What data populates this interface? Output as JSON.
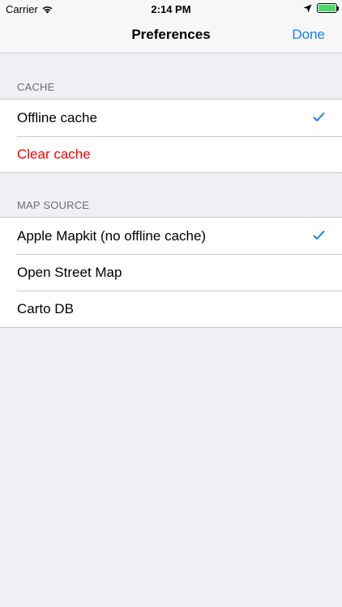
{
  "status_bar": {
    "carrier": "Carrier",
    "time": "2:14 PM"
  },
  "nav": {
    "title": "Preferences",
    "done_label": "Done"
  },
  "sections": {
    "cache": {
      "header": "CACHE",
      "items": [
        {
          "label": "Offline cache",
          "checked": true
        },
        {
          "label": "Clear cache",
          "destructive": true
        }
      ]
    },
    "map_source": {
      "header": "MAP SOURCE",
      "items": [
        {
          "label": "Apple Mapkit (no offline cache)",
          "checked": true
        },
        {
          "label": "Open Street Map",
          "checked": false
        },
        {
          "label": "Carto DB",
          "checked": false
        }
      ]
    }
  },
  "colors": {
    "accent": "#157efb",
    "destructive": "#ff0000",
    "background": "#efeff4",
    "battery": "#4cd964"
  },
  "icons": {
    "signal": "wifi-icon",
    "location": "location-arrow-icon",
    "battery": "battery-icon",
    "check": "checkmark-icon"
  }
}
